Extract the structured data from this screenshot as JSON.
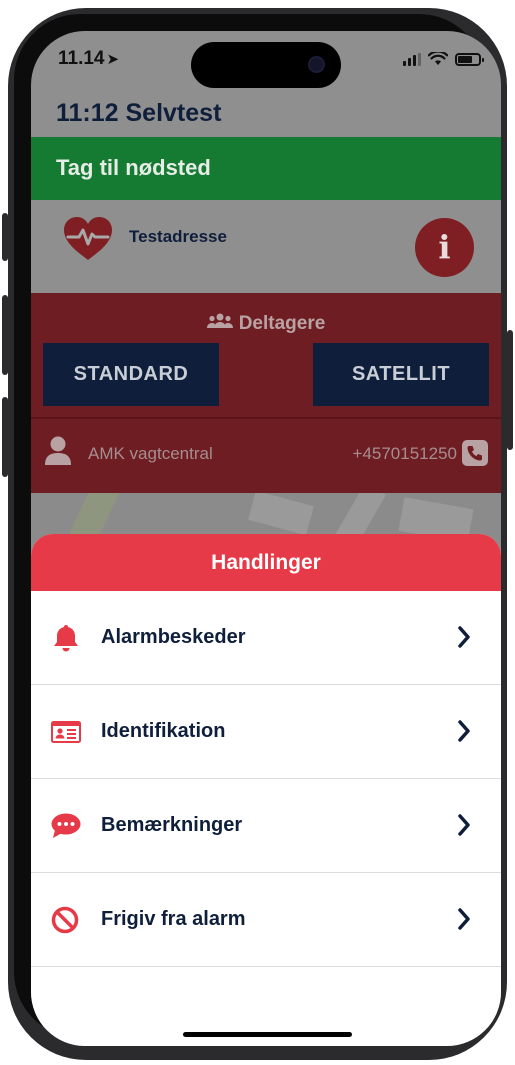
{
  "status_bar": {
    "time": "11.14",
    "location_glyph": "➤"
  },
  "app": {
    "title": "11:12 Selvtest",
    "action_banner": "Tag til nødsted",
    "address_label": "Testadresse",
    "info_glyph": "i",
    "participants_title": "Deltagere",
    "map_buttons": [
      "STANDARD",
      "SATELLIT"
    ],
    "contact": {
      "name": "AMK vagtcentral",
      "phone": "+4570151250"
    }
  },
  "sheet": {
    "title": "Handlinger",
    "items": [
      {
        "label": "Alarmbeskeder",
        "icon": "bell-icon"
      },
      {
        "label": "Identifikation",
        "icon": "id-card-icon"
      },
      {
        "label": "Bemærkninger",
        "icon": "comment-icon"
      },
      {
        "label": "Frigiv fra alarm",
        "icon": "ban-icon"
      }
    ]
  },
  "colors": {
    "accent_red": "#e73a48",
    "navy": "#0f1f3b",
    "green": "#157a32"
  }
}
